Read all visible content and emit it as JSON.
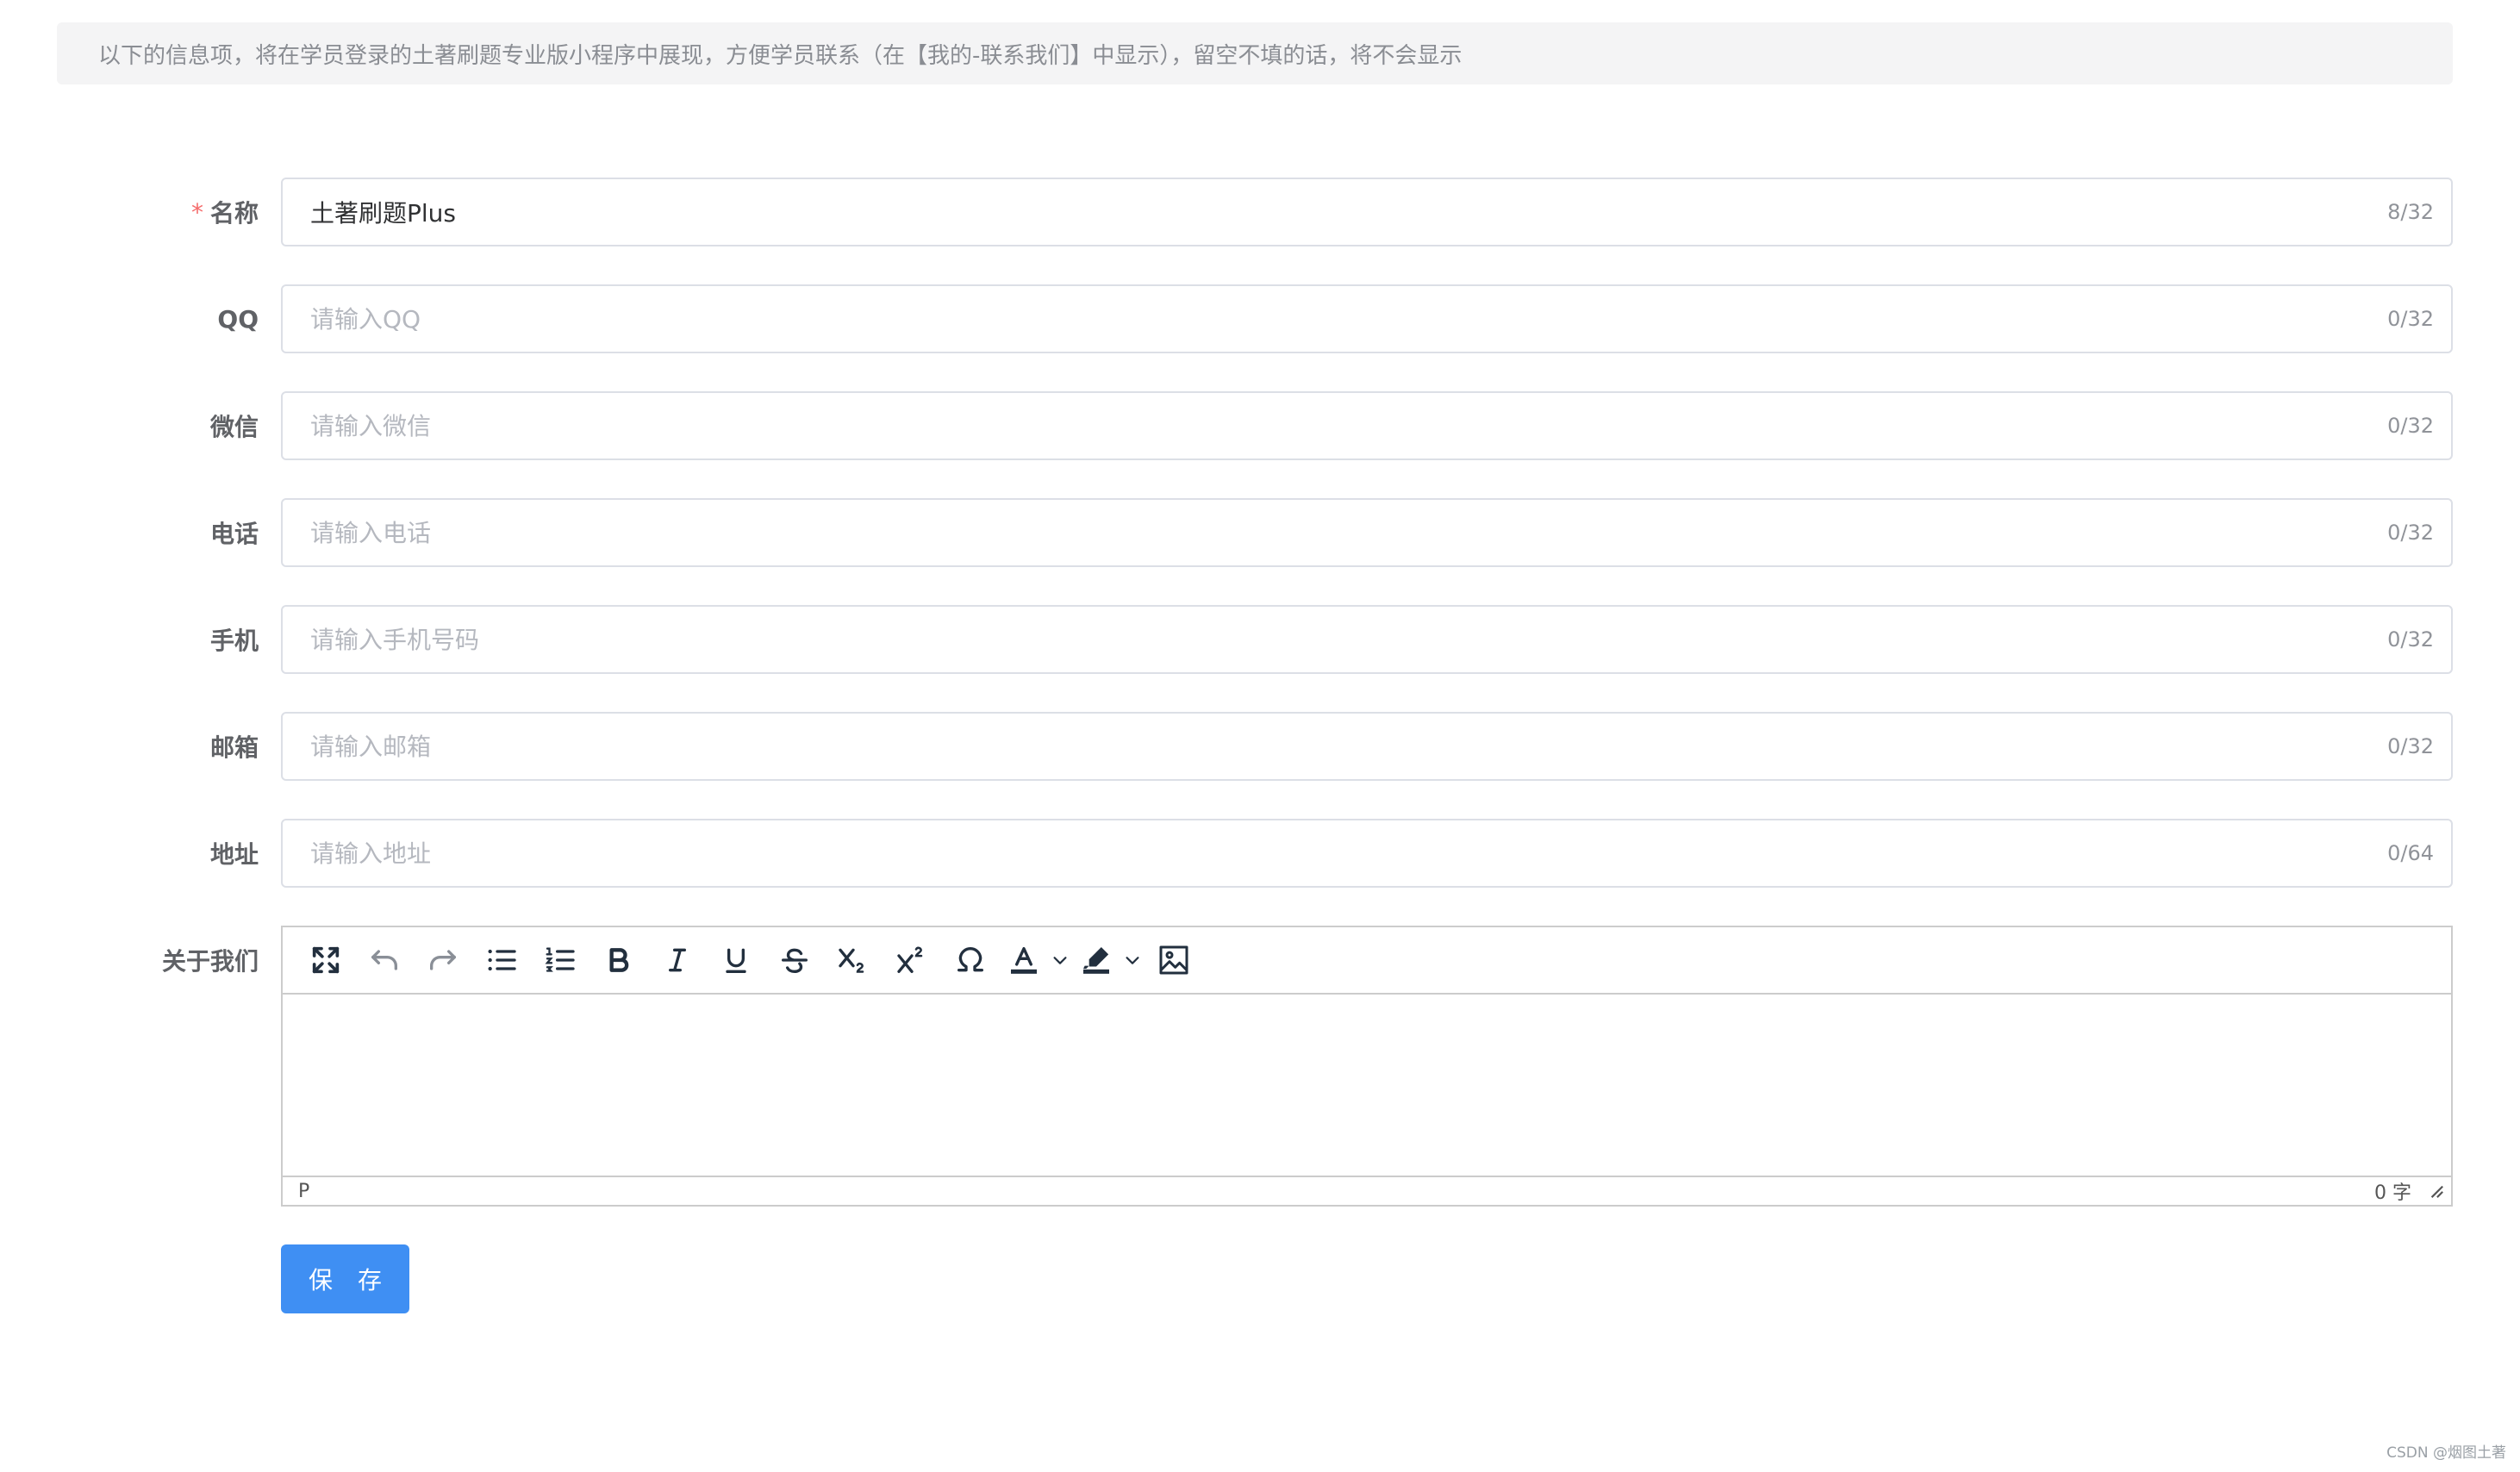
{
  "notice": "以下的信息项，将在学员登录的土著刷题专业版小程序中展现，方便学员联系（在【我的-联系我们】中显示），留空不填的话，将不会显示",
  "fields": [
    {
      "label": "名称",
      "required": true,
      "value": "土著刷题Plus",
      "placeholder": "",
      "counter": "8/32"
    },
    {
      "label": "QQ",
      "required": false,
      "value": "",
      "placeholder": "请输入QQ",
      "counter": "0/32"
    },
    {
      "label": "微信",
      "required": false,
      "value": "",
      "placeholder": "请输入微信",
      "counter": "0/32"
    },
    {
      "label": "电话",
      "required": false,
      "value": "",
      "placeholder": "请输入电话",
      "counter": "0/32"
    },
    {
      "label": "手机",
      "required": false,
      "value": "",
      "placeholder": "请输入手机号码",
      "counter": "0/32"
    },
    {
      "label": "邮箱",
      "required": false,
      "value": "",
      "placeholder": "请输入邮箱",
      "counter": "0/32"
    },
    {
      "label": "地址",
      "required": false,
      "value": "",
      "placeholder": "请输入地址",
      "counter": "0/64"
    }
  ],
  "editor": {
    "label": "关于我们",
    "toolbar_icons": [
      "fullscreen-icon",
      "undo-icon",
      "redo-icon",
      "bullet-list-icon",
      "numbered-list-icon",
      "bold-icon",
      "italic-icon",
      "underline-icon",
      "strikethrough-icon",
      "subscript-icon",
      "superscript-icon",
      "special-character-icon",
      "text-color-icon",
      "highlight-color-icon",
      "image-icon"
    ],
    "status_path": "P",
    "word_count": "0 字"
  },
  "save_label": "保 存",
  "watermark": "CSDN @烟图土著",
  "colors": {
    "primary": "#3f8ff3",
    "required": "#f56c6c",
    "notice_bg": "#f4f4f5"
  }
}
